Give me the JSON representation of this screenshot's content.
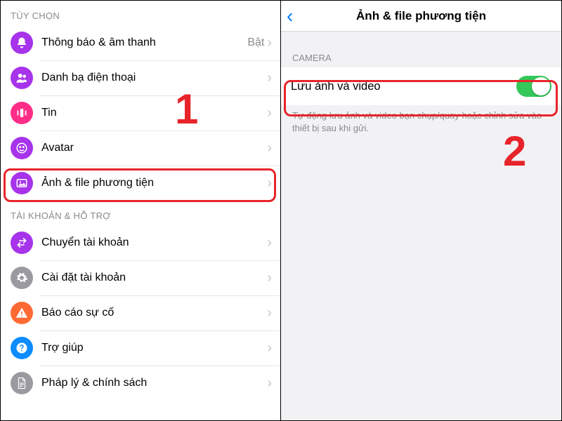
{
  "left": {
    "section1_header": "TÙY CHỌN",
    "items1": [
      {
        "label": "Thông báo & âm thanh",
        "value": "Bật",
        "icon": "bell",
        "color": "#a733ea"
      },
      {
        "label": "Danh bạ điện thoại",
        "value": "",
        "icon": "people",
        "color": "#a733ea"
      },
      {
        "label": "Tin",
        "value": "",
        "icon": "panel",
        "color": "#ff2d87"
      },
      {
        "label": "Avatar",
        "value": "",
        "icon": "smile",
        "color": "#a733ea"
      },
      {
        "label": "Ảnh & file phương tiện",
        "value": "",
        "icon": "image",
        "color": "#a733ea"
      }
    ],
    "section2_header": "TÀI KHOẢN & HỖ TRỢ",
    "items2": [
      {
        "label": "Chuyển tài khoản",
        "value": "",
        "icon": "switch",
        "color": "#a733ea"
      },
      {
        "label": "Cài đặt tài khoản",
        "value": "",
        "icon": "gear",
        "color": "#9a9aa0"
      },
      {
        "label": "Báo cáo sự cố",
        "value": "",
        "icon": "alert",
        "color": "#ff6a34"
      },
      {
        "label": "Trợ giúp",
        "value": "",
        "icon": "help",
        "color": "#0b8cff"
      },
      {
        "label": "Pháp lý & chính sách",
        "value": "",
        "icon": "doc",
        "color": "#9a9aa0"
      }
    ]
  },
  "right": {
    "nav_title": "Ảnh & file phương tiện",
    "camera_header": "CAMERA",
    "save_label": "Lưu ảnh và video",
    "save_desc": "Tự động lưu ảnh và video bạn chụp/quay hoặc chỉnh sửa vào thiết bị sau khi gửi."
  },
  "annotations": {
    "a1": "1",
    "a2": "2"
  }
}
